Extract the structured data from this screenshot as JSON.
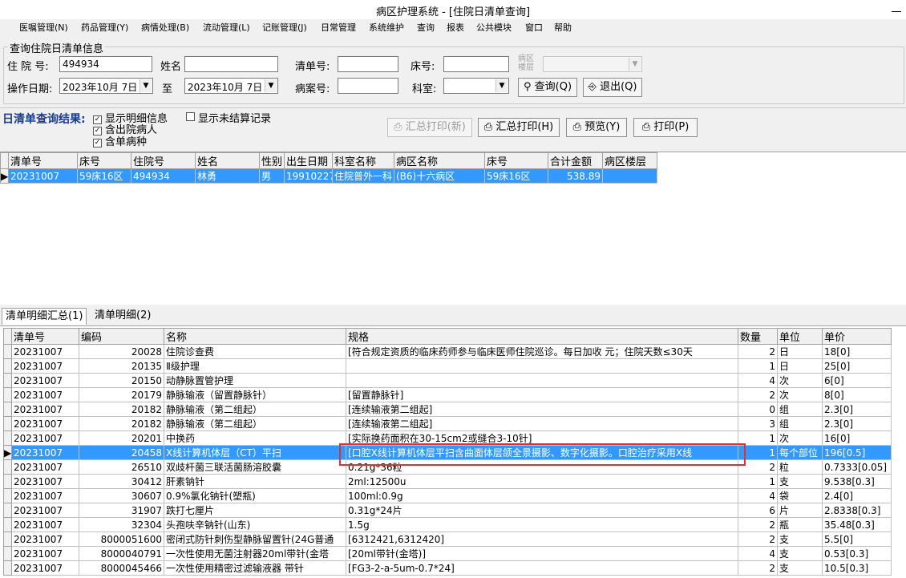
{
  "window": {
    "title": "病区护理系统 - [住院日清单查询]"
  },
  "menu": [
    "医嘱管理(N)",
    "药品管理(Y)",
    "病情处理(B)",
    "流动管理(L)",
    "记账管理(J)",
    "日常管理",
    "系统维护",
    "查询",
    "报表",
    "公共模块",
    "窗口",
    "帮助"
  ],
  "query": {
    "group_title": "查询住院日清单信息",
    "admission_label": "住 院 号:",
    "admission_value": "494934",
    "name_label": "姓名",
    "name_value": "",
    "bill_label": "清单号:",
    "bill_value": "",
    "bed_label": "床号:",
    "bed_value": "",
    "ward_floor_label_top": "病区",
    "ward_floor_label_bottom": "楼层",
    "ward_floor_value": "",
    "date_label": "操作日期:",
    "date_from": "2023年10月 7日",
    "date_to_label": "至",
    "date_to": "2023年10月 7日",
    "record_label": "病案号:",
    "record_value": "",
    "dept_label": "科室:",
    "dept_value": "",
    "search_button": "查询(Q)",
    "exit_button": "退出(Q)"
  },
  "results": {
    "label": "日清单查询结果:",
    "options": [
      {
        "label": "显示明细信息",
        "checked": true
      },
      {
        "label": "显示未结算记录",
        "checked": false
      },
      {
        "label": "含出院病人",
        "checked": true
      },
      {
        "label": "含单病种",
        "checked": true
      }
    ],
    "buttons": {
      "summary_print_new": "汇总打印(新)",
      "summary_print": "汇总打印(H)",
      "preview": "预览(Y)",
      "print": "打印(P)"
    }
  },
  "summary_table": {
    "columns": [
      "清单号",
      "床号",
      "住院号",
      "姓名",
      "性别",
      "出生日期",
      "科室名称",
      "病区名称",
      "床号",
      "合计金额",
      "病区楼层"
    ],
    "rows": [
      [
        "20231007",
        "59床16区",
        "494934",
        "林勇",
        "男",
        "19910227",
        "住院普外一科",
        "(B6)十六病区",
        "59床16区",
        "538.89",
        ""
      ]
    ]
  },
  "tabs": [
    "清单明细汇总(1)",
    "清单明细(2)"
  ],
  "detail_table": {
    "columns": [
      "清单号",
      "编码",
      "名称",
      "规格",
      "数量",
      "单位",
      "单价"
    ],
    "rows": [
      [
        "20231007",
        "20028",
        "住院诊查费",
        "[符合规定资质的临床药师参与临床医师住院巡诊。每日加收  元；住院天数≤30天",
        "2",
        "日",
        "18[0]"
      ],
      [
        "20231007",
        "20135",
        "Ⅱ级护理",
        "",
        "1",
        "日",
        "25[0]"
      ],
      [
        "20231007",
        "20150",
        "动静脉置管护理",
        "",
        "4",
        "次",
        "6[0]"
      ],
      [
        "20231007",
        "20179",
        "静脉输液（留置静脉针）",
        "[留置静脉针]",
        "2",
        "次",
        "8[0]"
      ],
      [
        "20231007",
        "20182",
        "静脉输液（第二组起）",
        "[连续输液第二组起]",
        "0",
        "组",
        "2.3[0]"
      ],
      [
        "20231007",
        "20182",
        "静脉输液（第二组起）",
        "[连续输液第二组起]",
        "3",
        "组",
        "2.3[0]"
      ],
      [
        "20231007",
        "20201",
        "中换药",
        "[实际换药面积在30-15cm2或缝合3-10针]",
        "1",
        "次",
        "16[0]"
      ],
      [
        "20231007",
        "20458",
        "X线计算机体层（CT）平扫",
        "[口腔X线计算机体层平扫含曲面体层颌全景摄影、数字化摄影。口腔治疗采用X线",
        "1",
        "每个部位",
        "196[0.5]"
      ],
      [
        "20231007",
        "26510",
        "双歧杆菌三联活菌肠溶胶囊",
        "0.21g*36粒",
        "2",
        "粒",
        "0.7333[0.05]"
      ],
      [
        "20231007",
        "30412",
        "肝素钠针",
        "2ml:12500u",
        "1",
        "支",
        "9.538[0.3]"
      ],
      [
        "20231007",
        "30607",
        "0.9%氯化钠针(塑瓶)",
        "100ml:0.9g",
        "4",
        "袋",
        "2.4[0]"
      ],
      [
        "20231007",
        "31907",
        "跌打七厘片",
        "0.31g*24片",
        "6",
        "片",
        "2.8338[0.3]"
      ],
      [
        "20231007",
        "32304",
        "头孢呋辛钠针(山东)",
        "1.5g",
        "2",
        "瓶",
        "35.48[0.3]"
      ],
      [
        "20231007",
        "8000051600",
        "密闭式防针刺伤型静脉留置针(24G普通",
        "[6312421,6312420]",
        "2",
        "支",
        "5.5[0]"
      ],
      [
        "20231007",
        "8000040791",
        "一次性使用无菌注射器20ml带针(金塔",
        "[20ml带针(金塔)]",
        "4",
        "支",
        "0.53[0.3]"
      ],
      [
        "20231007",
        "8000045466",
        "一次性使用精密过滤输液器 带针",
        "[FG3-2-a-5um-0.7*24]",
        "2",
        "支",
        "10.5[0.3]"
      ]
    ]
  },
  "colors": {
    "selection": "#3399ff",
    "result_label": "#1c3d8f",
    "highlight_box": "#e03030"
  }
}
